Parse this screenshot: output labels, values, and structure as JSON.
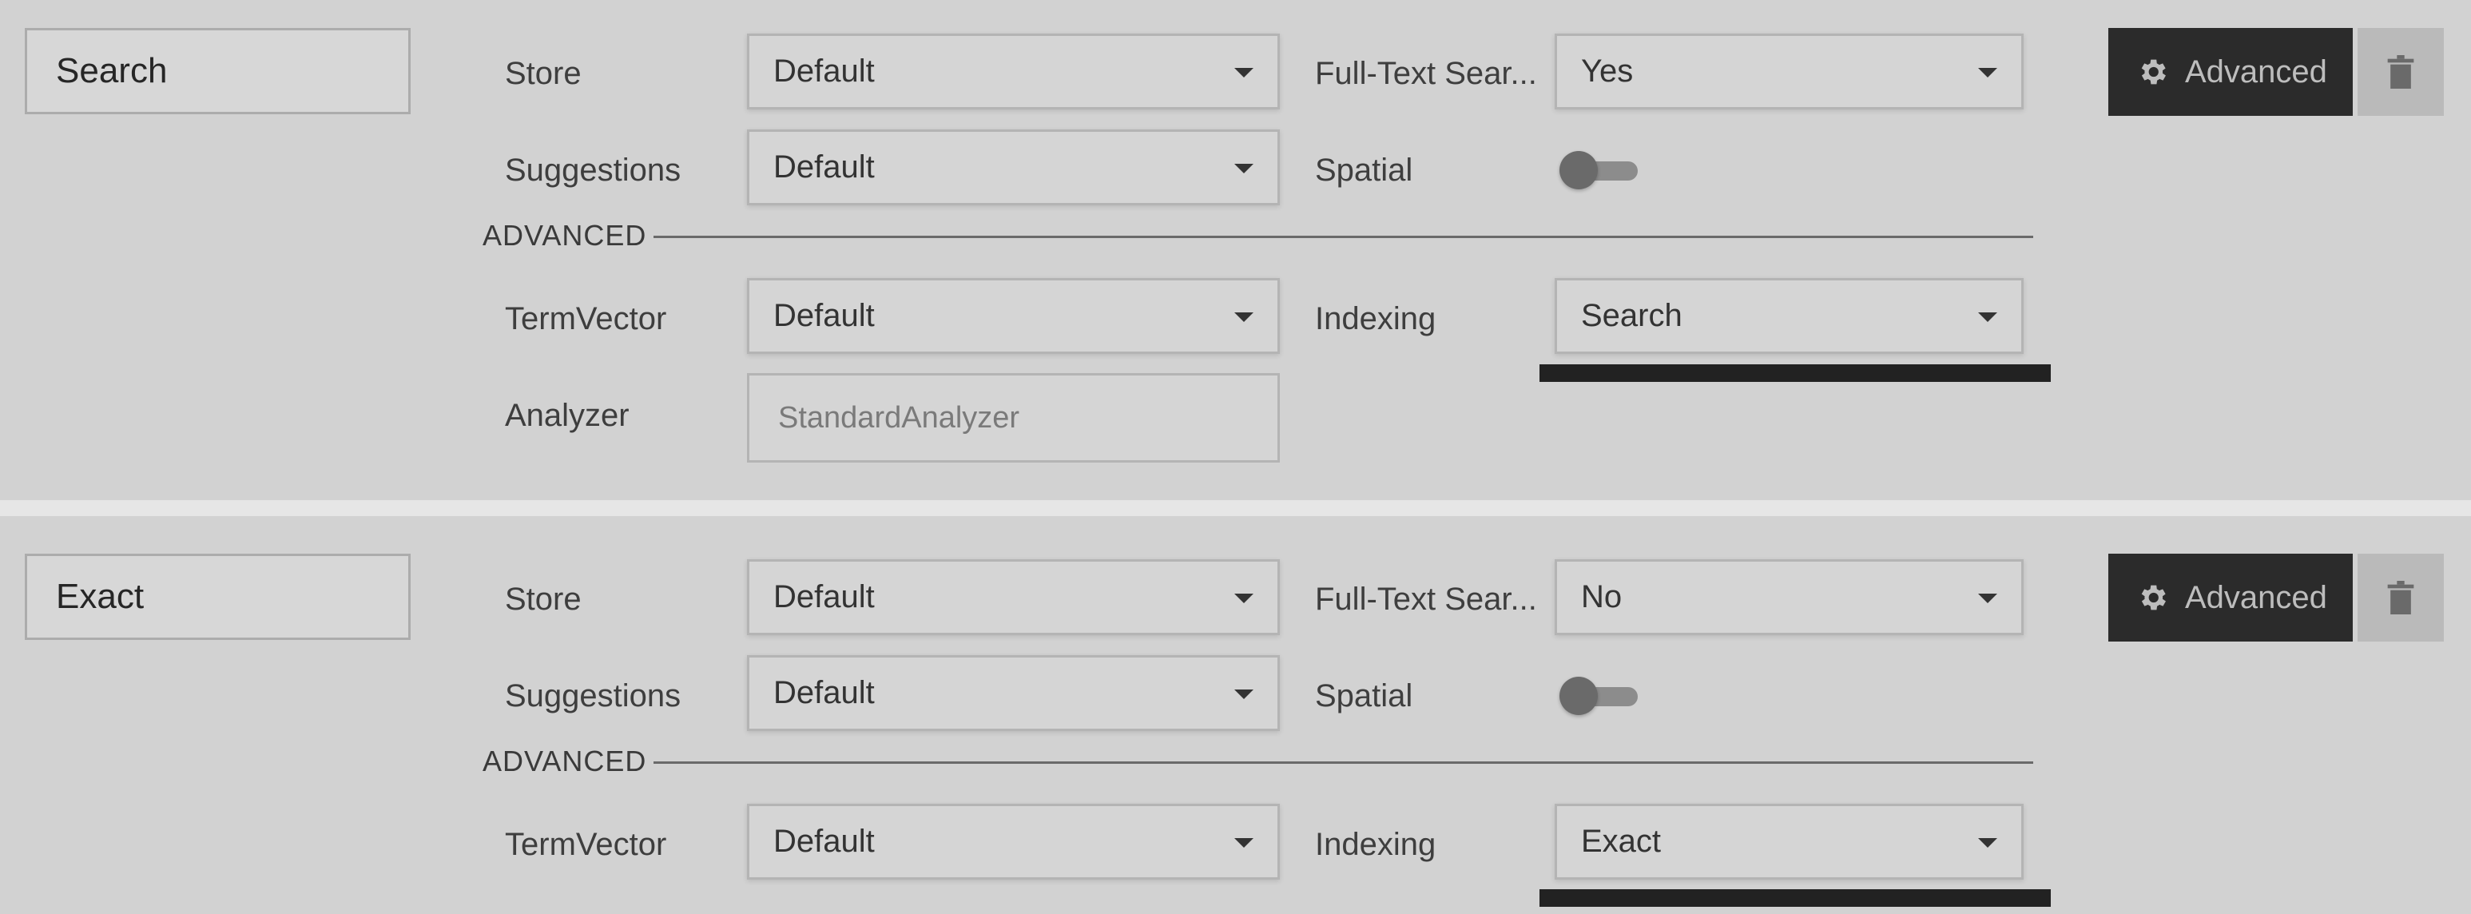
{
  "labels": {
    "store": "Store",
    "fts": "Full-Text Sear...",
    "suggestions": "Suggestions",
    "spatial": "Spatial",
    "advanced_section": "ADVANCED",
    "termvector": "TermVector",
    "indexing": "Indexing",
    "analyzer": "Analyzer",
    "advanced_button": "Advanced"
  },
  "icons": {
    "advanced": "gear-icon",
    "delete": "trash-icon",
    "dropdown": "caret-down-icon"
  },
  "fields": [
    {
      "name": "Search",
      "store": "Default",
      "fts": "Yes",
      "suggestions": "Default",
      "spatial_enabled": false,
      "termvector": "Default",
      "indexing": "Search",
      "analyzer": "StandardAnalyzer"
    },
    {
      "name": "Exact",
      "store": "Default",
      "fts": "No",
      "suggestions": "Default",
      "spatial_enabled": false,
      "termvector": "Default",
      "indexing": "Exact"
    }
  ]
}
